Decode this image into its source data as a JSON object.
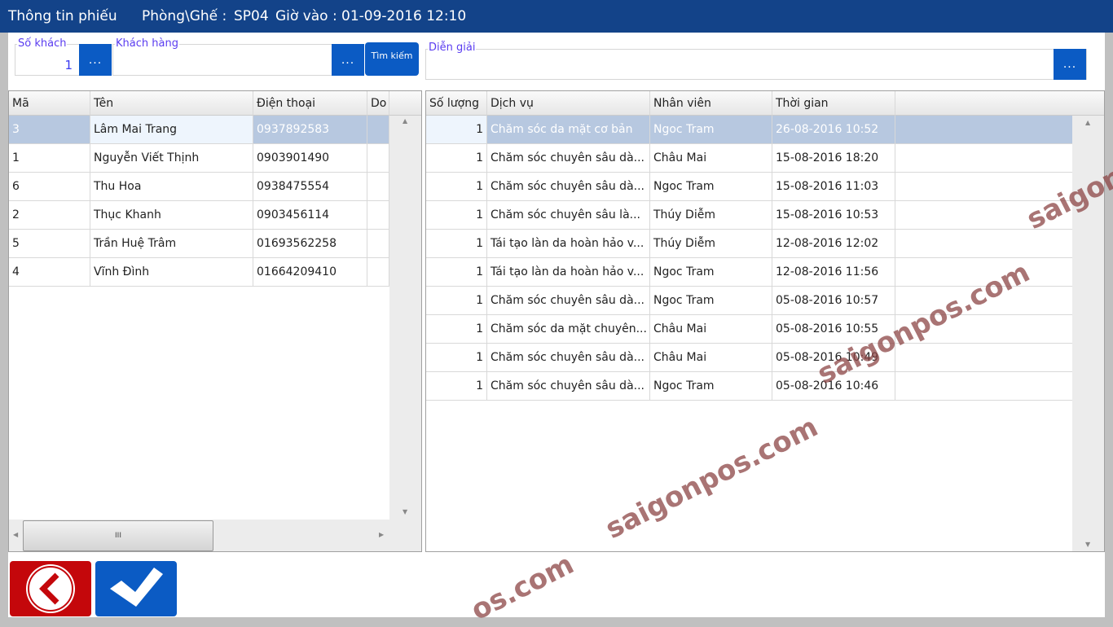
{
  "header": {
    "title": "Thông tin phiếu",
    "room_label": "Phòng\\Ghế :",
    "room_value": "SP04",
    "time_label": "Giờ vào :",
    "time_value": "01-09-2016 12:10"
  },
  "form": {
    "guests_label": "Số khách",
    "guests_value": "1",
    "customer_label": "Khách hàng",
    "customer_value": "",
    "dots": "...",
    "search_label": "Tìm kiếm",
    "notes_label": "Diễn giải",
    "notes_value": ""
  },
  "customers": {
    "columns": [
      "Mã",
      "Tên",
      "Điện thoại",
      "Do"
    ],
    "rows": [
      [
        "3",
        "Lâm Mai Trang",
        "0937892583"
      ],
      [
        "1",
        "Nguyễn Viết Thịnh",
        "0903901490"
      ],
      [
        "6",
        "Thu Hoa",
        "0938475554"
      ],
      [
        "2",
        "Thục Khanh",
        "0903456114"
      ],
      [
        "5",
        "Trần Huệ Trâm",
        "01693562258"
      ],
      [
        "4",
        "Vĩnh Đình",
        "01664209410"
      ]
    ],
    "selected": 0
  },
  "services": {
    "columns": [
      "Số lượng",
      "Dịch vụ",
      "Nhân viên",
      "Thời gian"
    ],
    "rows": [
      [
        "1",
        "Chăm sóc da mặt cơ bản",
        "Ngoc Tram",
        "26-08-2016 10:52"
      ],
      [
        "1",
        "Chăm sóc chuyên sâu dà...",
        "Châu Mai",
        "15-08-2016 18:20"
      ],
      [
        "1",
        "Chăm sóc chuyên sâu dà...",
        "Ngoc Tram",
        "15-08-2016 11:03"
      ],
      [
        "1",
        "Chăm sóc chuyên sâu là...",
        "Thúy Diễm",
        "15-08-2016 10:53"
      ],
      [
        "1",
        "Tái tạo làn da hoàn hảo v...",
        "Thúy Diễm",
        "12-08-2016 12:02"
      ],
      [
        "1",
        "Tái tạo làn da hoàn hảo v...",
        "Ngoc Tram",
        "12-08-2016 11:56"
      ],
      [
        "1",
        "Chăm sóc chuyên sâu dà...",
        "Ngoc Tram",
        "05-08-2016 10:57"
      ],
      [
        "1",
        "Chăm sóc da mặt chuyên...",
        "Châu Mai",
        "05-08-2016 10:55"
      ],
      [
        "1",
        "Chăm sóc chuyên sâu dà...",
        "Châu Mai",
        "05-08-2016 10:49"
      ],
      [
        "1",
        "Chăm sóc chuyên sâu dà...",
        "Ngoc Tram",
        "05-08-2016 10:46"
      ]
    ],
    "selected": 0
  },
  "scroll": {
    "grip": "III"
  },
  "watermark": "saigonpos.com",
  "colors": {
    "header": "#134389",
    "accent": "#0b5bc4",
    "back": "#c4070b"
  }
}
